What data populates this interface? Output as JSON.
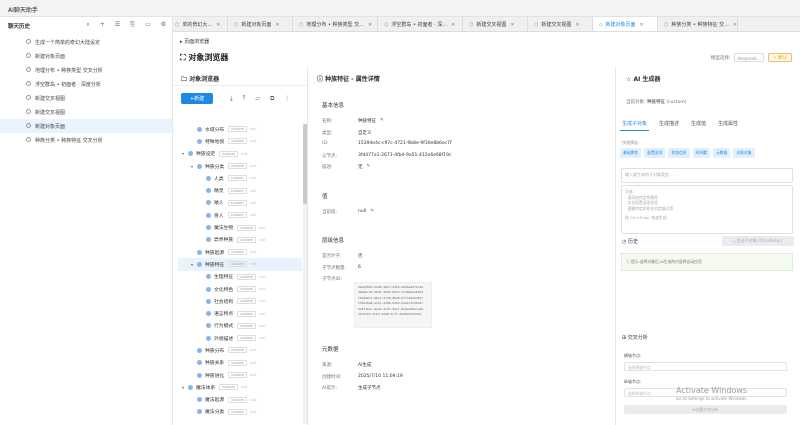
{
  "app": {
    "title": "AI聊天助手"
  },
  "sidebar": {
    "title": "聊天历史",
    "items": [
      {
        "label": "生成一个简单的奇幻大陆设定",
        "selected": false
      },
      {
        "label": "新建对象页面",
        "selected": false
      },
      {
        "label": "地理分布 • 种族类型 交叉分析",
        "selected": false
      },
      {
        "label": "浮空群岛 • 初面者 · 深度分析",
        "selected": false
      },
      {
        "label": "新建交叉视图",
        "selected": false
      },
      {
        "label": "新建交叉视图",
        "selected": false
      },
      {
        "label": "新建对象页面",
        "selected": true
      },
      {
        "label": "种族分类 • 种族特征 交叉分析",
        "selected": false
      }
    ]
  },
  "tabs": [
    {
      "label": "单的奇幻大...",
      "active": false
    },
    {
      "label": "新建对象页面",
      "active": false
    },
    {
      "label": "地理分布 • 种族类型 交...",
      "active": false
    },
    {
      "label": "浮空群岛 • 初面者 · 深...",
      "active": false
    },
    {
      "label": "新建交叉视图",
      "active": false
    },
    {
      "label": "新建交叉视图",
      "active": false
    },
    {
      "label": "新建对象页面",
      "active": true
    },
    {
      "label": "种族分类 • 种族特征 交...",
      "active": false
    }
  ],
  "breadcrumb": "页面浏览器",
  "page_title": "对象浏览器",
  "model": {
    "label": "模型选择:",
    "placeholder": "deepseek...",
    "button": "默认"
  },
  "browser": {
    "title": "对象浏览器",
    "new_button": "新建",
    "tree": [
      {
        "label": "水域分布",
        "depth": 2,
        "arrow": "",
        "tag": "custom",
        "tag2": "null",
        "selected": false
      },
      {
        "label": "特殊地貌",
        "depth": 2,
        "arrow": "",
        "tag": "custom",
        "tag2": "null",
        "selected": false
      },
      {
        "label": "种族设定",
        "depth": 1,
        "arrow": "▾",
        "tag": "custom",
        "tag2": "null",
        "selected": false
      },
      {
        "label": "种族分类",
        "depth": 2,
        "arrow": "▾",
        "tag": "custom",
        "tag2": "null",
        "selected": false
      },
      {
        "label": "人类",
        "depth": 3,
        "arrow": "",
        "tag": "custom",
        "tag2": "null",
        "selected": false
      },
      {
        "label": "精灵",
        "depth": 3,
        "arrow": "",
        "tag": "custom",
        "tag2": "null",
        "selected": false
      },
      {
        "label": "矮人",
        "depth": 3,
        "arrow": "",
        "tag": "custom",
        "tag2": "null",
        "selected": false
      },
      {
        "label": "兽人",
        "depth": 3,
        "arrow": "",
        "tag": "custom",
        "tag2": "null",
        "selected": false
      },
      {
        "label": "魔法生物",
        "depth": 3,
        "arrow": "",
        "tag": "custom",
        "tag2": "null",
        "selected": false
      },
      {
        "label": "异界种族",
        "depth": 3,
        "arrow": "",
        "tag": "custom",
        "tag2": "null",
        "selected": false
      },
      {
        "label": "种族起源",
        "depth": 2,
        "arrow": "",
        "tag": "custom",
        "tag2": "null",
        "selected": false
      },
      {
        "label": "种族特征",
        "depth": 2,
        "arrow": "▾",
        "tag": "custom",
        "tag2": "null",
        "selected": true
      },
      {
        "label": "生理特征",
        "depth": 3,
        "arrow": "",
        "tag": "custom",
        "tag2": "null",
        "selected": false
      },
      {
        "label": "文化特色",
        "depth": 3,
        "arrow": "",
        "tag": "custom",
        "tag2": "null",
        "selected": false
      },
      {
        "label": "社会结构",
        "depth": 3,
        "arrow": "",
        "tag": "custom",
        "tag2": "null",
        "selected": false
      },
      {
        "label": "语言特点",
        "depth": 3,
        "arrow": "",
        "tag": "custom",
        "tag2": "null",
        "selected": false
      },
      {
        "label": "行为模式",
        "depth": 3,
        "arrow": "",
        "tag": "custom",
        "tag2": "null",
        "selected": false
      },
      {
        "label": "外貌描述",
        "depth": 3,
        "arrow": "",
        "tag": "custom",
        "tag2": "null",
        "selected": false
      },
      {
        "label": "种族分布",
        "depth": 2,
        "arrow": "",
        "tag": "custom",
        "tag2": "null",
        "selected": false
      },
      {
        "label": "种族关系",
        "depth": 2,
        "arrow": "",
        "tag": "custom",
        "tag2": "null",
        "selected": false
      },
      {
        "label": "种族进化",
        "depth": 2,
        "arrow": "",
        "tag": "custom",
        "tag2": "null",
        "selected": false
      },
      {
        "label": "魔法体系",
        "depth": 1,
        "arrow": "▾",
        "tag": "custom",
        "tag2": "null",
        "selected": false
      },
      {
        "label": "魔法起源",
        "depth": 2,
        "arrow": "",
        "tag": "custom",
        "tag2": "null",
        "selected": false
      },
      {
        "label": "魔法分类",
        "depth": 2,
        "arrow": "",
        "tag": "custom",
        "tag2": "null",
        "selected": false
      }
    ]
  },
  "detail": {
    "title": "种族特征 - 属性详情",
    "basic": {
      "heading": "基本信息",
      "rows": [
        {
          "k": "名称:",
          "v": "种族特征"
        },
        {
          "k": "类型:",
          "v": "自定义"
        },
        {
          "k": "ID:",
          "v": "1539de4c-c97c-4721-9b8e-9f30e8b6ec7f"
        },
        {
          "k": "父节点:",
          "v": "3fd477a1-2671-4fbd-9a51-412a6e68f19c"
        },
        {
          "k": "描述:",
          "v": "无"
        }
      ]
    },
    "value": {
      "heading": "值",
      "k": "当前值:",
      "v": "null"
    },
    "hier": {
      "heading": "层级信息",
      "rows": [
        {
          "k": "是否叶子:",
          "v": "否"
        },
        {
          "k": "子节点数量:",
          "v": "6"
        },
        {
          "k": "子节点ID:",
          "v": ""
        }
      ]
    },
    "child_ids": [
      "9bad5093-b2a6-4613-a352-46b6e4d74c4e",
      "a6a66c43-9092-4b58-b6c6-97d4b6da5a54",
      "f9d4a8c3-98c2-4748-8b28-ef7c62dad3d7",
      "1f0ed6a8-a1ac-4d0b-b252-61e4c3c65a3c",
      "5d4f1b2c-6a3e-4c07-9b1f-8e0a4d6bcaa0",
      "22c5d23-3c63-4da8-bc7f-8320a12f6d21"
    ],
    "meta": {
      "heading": "元数据",
      "rows": [
        {
          "k": "来源:",
          "v": "AI生成"
        },
        {
          "k": "创建时间:",
          "v": "2025/7/10 11:09:19"
        },
        {
          "k": "AI提示:",
          "v": "生成子节点"
        }
      ]
    }
  },
  "ai": {
    "title": "AI 生成器",
    "current_label": "当前对象:",
    "current_value": "种族特征",
    "current_tag": "(custom)",
    "tabs": [
      {
        "label": "生成子对象",
        "active": true
      },
      {
        "label": "生成描述",
        "active": false
      },
      {
        "label": "生成值",
        "active": false
      },
      {
        "label": "生成属性",
        "active": false
      }
    ],
    "quick_label": "快速模板:",
    "chips": [
      "基础属性",
      "配置选项",
      "状态信息",
      "时间戳",
      "元数据",
      "关联对象"
    ],
    "input_placeholder": "输入要生成的子对象类型...",
    "prompt_text": [
      "可选:",
      "- 请添加特定的属性",
      "- 包含配置选项信息",
      "- 遵循特定的命名约定格式等"
    ],
    "prompt_hint": "按 Ctrl+Enter 快速生成",
    "history_label": "历史",
    "generate_button": "生成子对象 (Ctrl+Enter)",
    "notice": "提示:选择对象后,AI生成的内容将自动应用",
    "cross": {
      "title": "交叉分析",
      "row_label": "横轴节点:",
      "row_placeholder": "选择横轴节点",
      "col_label": "纵轴节点:",
      "col_placeholder": "选择纵轴节点",
      "button": "创建交叉分析"
    }
  },
  "watermark": {
    "line1": "Activate Windows",
    "line2": "Go to Settings to activate Windows."
  },
  "colors": {
    "accent": "#1e88e5",
    "selected_bg": "#e8f3fd"
  }
}
